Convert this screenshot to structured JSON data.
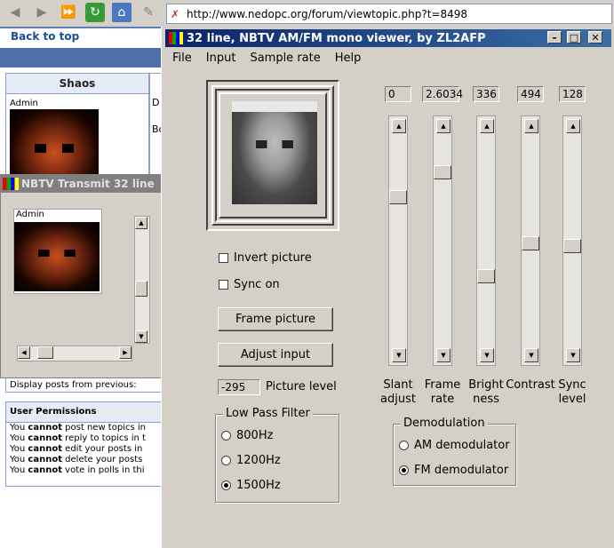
{
  "browser": {
    "url": "http://www.nedopc.org/forum/viewtopic.php?t=8498"
  },
  "forum": {
    "back_to_top": "Back to top",
    "poster_name": "Shaos",
    "poster_role": "Admin",
    "post_col_line1": "D",
    "post_col_line2": "Bo",
    "display_posts": "Display posts from previous:",
    "permissions_title": "User Permissions",
    "permissions": [
      {
        "pre": "You ",
        "strong": "cannot",
        "post": " post new topics in"
      },
      {
        "pre": "You ",
        "strong": "cannot",
        "post": " reply to topics in t"
      },
      {
        "pre": "You ",
        "strong": "cannot",
        "post": " edit your posts in"
      },
      {
        "pre": "You ",
        "strong": "cannot",
        "post": " delete your posts"
      },
      {
        "pre": "You ",
        "strong": "cannot",
        "post": " vote in polls in thi"
      }
    ]
  },
  "transmit": {
    "title": "NBTV Transmit 32 line",
    "role": "Admin"
  },
  "viewer": {
    "title": "32 line, NBTV AM/FM mono viewer, by ZL2AFP",
    "menus": [
      "File",
      "Input",
      "Sample rate",
      "Help"
    ],
    "invert_picture": "Invert picture",
    "sync_on": "Sync on",
    "frame_picture": "Frame picture",
    "adjust_input": "Adjust input",
    "picture_level_value": "-295",
    "picture_level_label": "Picture level",
    "low_pass": {
      "title": "Low Pass Filter",
      "options": [
        "800Hz",
        "1200Hz",
        "1500Hz"
      ],
      "selected": "1500Hz"
    },
    "demod": {
      "title": "Demodulation",
      "options": [
        "AM demodulator",
        "FM demodulator"
      ],
      "selected": "FM demodulator"
    },
    "sliders": [
      {
        "value": "0",
        "label1": "Slant",
        "label2": "adjust",
        "level": 0.28
      },
      {
        "value": "2.6034",
        "label1": "Frame",
        "label2": "rate",
        "level": 0.16
      },
      {
        "value": "336",
        "label1": "Bright",
        "label2": "ness",
        "level": 0.67
      },
      {
        "value": "494",
        "label1": "Contrast",
        "label2": "",
        "level": 0.51
      },
      {
        "value": "128",
        "label1": "Sync",
        "label2": "level",
        "level": 0.52
      }
    ]
  },
  "colors": {
    "title_bar": "#0a246a",
    "face": "#d4d0c8",
    "forum_link": "#1b4d96"
  }
}
